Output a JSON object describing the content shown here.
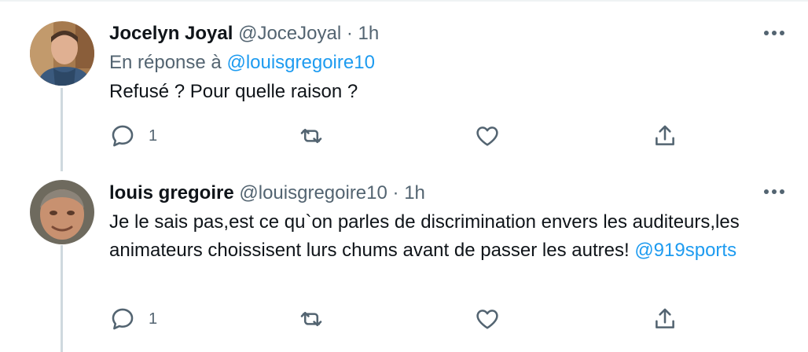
{
  "tweets": [
    {
      "name": "Jocelyn Joyal",
      "handle": "@JoceJoyal",
      "separator": "·",
      "time": "1h",
      "reply_prefix": "En réponse à",
      "reply_mention": "@louisgregoire10",
      "text": "Refusé ? Pour quelle raison ?",
      "mention": "",
      "reply_count": "1"
    },
    {
      "name": "louis gregoire",
      "handle": "@louisgregoire10",
      "separator": "·",
      "time": "1h",
      "text": "Je le sais pas,est ce qu`on parles de discrimination envers les auditeurs,les animateurs choissisent lurs chums avant de passer les autres! ",
      "mention": "@919sports",
      "reply_count": "1"
    }
  ],
  "icons": {
    "more": "more-horizontal-icon",
    "reply": "reply-bubble-icon",
    "retweet": "retweet-icon",
    "like": "heart-icon",
    "share": "share-icon"
  },
  "colors": {
    "text": "#0f1419",
    "secondary": "#536471",
    "link": "#1d9bf0",
    "thread_line": "#cfd9de"
  }
}
